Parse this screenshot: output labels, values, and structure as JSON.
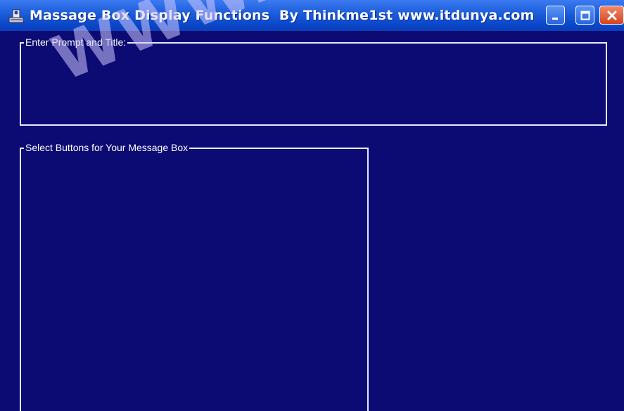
{
  "window": {
    "title": "Massage Box Display Functions  By Thinkme1st www.itdunya.com",
    "icon": "app-icon",
    "controls": {
      "minimize_icon": "minimize-icon",
      "maximize_icon": "maximize-icon",
      "close_icon": "close-icon"
    }
  },
  "watermark": "WWW.",
  "groups": {
    "prompt": {
      "label": "Enter Prompt and Title:"
    },
    "buttons": {
      "label": "Select Buttons for Your Message Box"
    }
  },
  "colors": {
    "background": "#0b0b73",
    "titlebar": "#0a47c9",
    "close": "#d5441f",
    "border": "#e8e8ff"
  }
}
